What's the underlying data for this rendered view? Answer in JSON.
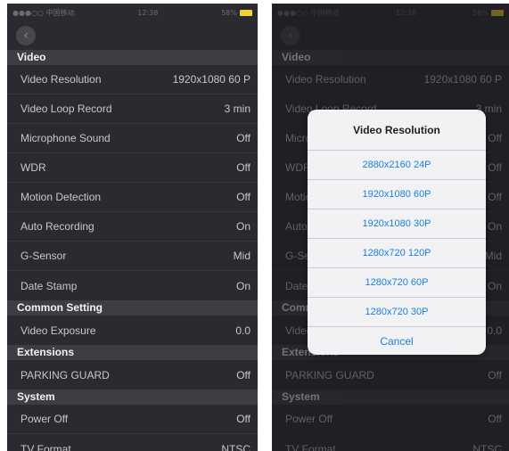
{
  "status": {
    "carrier": "●●●○○ 中国移动",
    "time": "12:38",
    "battery": "58%"
  },
  "nav": {
    "back_glyph": "‹"
  },
  "sections": {
    "video": "Video",
    "common": "Common Setting",
    "extensions": "Extensions",
    "system": "System"
  },
  "rows": {
    "video_resolution": {
      "label": "Video Resolution",
      "value": "1920x1080 60 P"
    },
    "video_loop_record": {
      "label": "Video Loop Record",
      "value": "3 min"
    },
    "microphone_sound": {
      "label": "Microphone Sound",
      "value": "Off"
    },
    "wdr": {
      "label": "WDR",
      "value": "Off"
    },
    "motion_detection": {
      "label": "Motion Detection",
      "value": "Off"
    },
    "auto_recording": {
      "label": "Auto Recording",
      "value": "On"
    },
    "g_sensor": {
      "label": "G-Sensor",
      "value": "Mid"
    },
    "date_stamp": {
      "label": "Date Stamp",
      "value": "On"
    },
    "video_exposure": {
      "label": "Video Exposure",
      "value": "0.0"
    },
    "parking_guard": {
      "label": "PARKING GUARD",
      "value": "Off"
    },
    "power_off": {
      "label": "Power Off",
      "value": "Off"
    },
    "tv_format": {
      "label": "TV Format",
      "value": "NTSC"
    }
  },
  "dialog": {
    "title": "Video Resolution",
    "options": [
      "2880x2160 24P",
      "1920x1080 60P",
      "1920x1080 30P",
      "1280x720 120P",
      "1280x720 60P",
      "1280x720 30P"
    ],
    "cancel": "Cancel"
  },
  "colors": {
    "background": "#2a2a30",
    "section": "#3d3d44",
    "accent": "#1a7fe0",
    "battery": "#f2d22e"
  }
}
